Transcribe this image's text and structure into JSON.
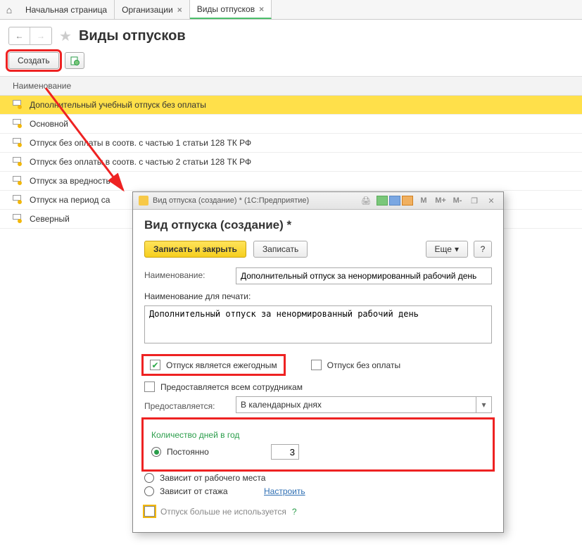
{
  "tabs": {
    "home": "Начальная страница",
    "org": "Организации",
    "types": "Виды отпусков"
  },
  "page": {
    "title": "Виды отпусков",
    "create": "Создать"
  },
  "list": {
    "header": "Наименование",
    "items": [
      "Дополнительный учебный отпуск без оплаты",
      "Основной",
      "Отпуск без оплаты в соотв. с частью 1 статьи 128 ТК РФ",
      "Отпуск без оплаты в соотв. с частью 2 статьи 128 ТК РФ",
      "Отпуск за вредность",
      "Отпуск на период са",
      "Северный"
    ]
  },
  "dialog": {
    "winTitle": "Вид отпуска (создание) * (1С:Предприятие)",
    "title": "Вид отпуска (создание) *",
    "saveClose": "Записать и закрыть",
    "save": "Записать",
    "more": "Еще",
    "q": "?",
    "name_label": "Наименование:",
    "name_value": "Дополнительный отпуск за ненормированный рабочий день",
    "print_label": "Наименование для печати:",
    "print_value": "Дополнительный отпуск за ненормированный рабочий день",
    "annual": "Отпуск является ежегодным",
    "unpaid": "Отпуск без оплаты",
    "allEmp": "Предоставляется всем сотрудникам",
    "granted_label": "Предоставляется:",
    "granted_value": "В календарных днях",
    "days_title": "Количество дней в год",
    "r1": "Постоянно",
    "r1_val": "3",
    "r2": "Зависит от рабочего места",
    "r3": "Зависит от стажа",
    "configure": "Настроить",
    "notUsed": "Отпуск больше не используется",
    "m": "M",
    "mplus": "M+",
    "mminus": "M-"
  }
}
